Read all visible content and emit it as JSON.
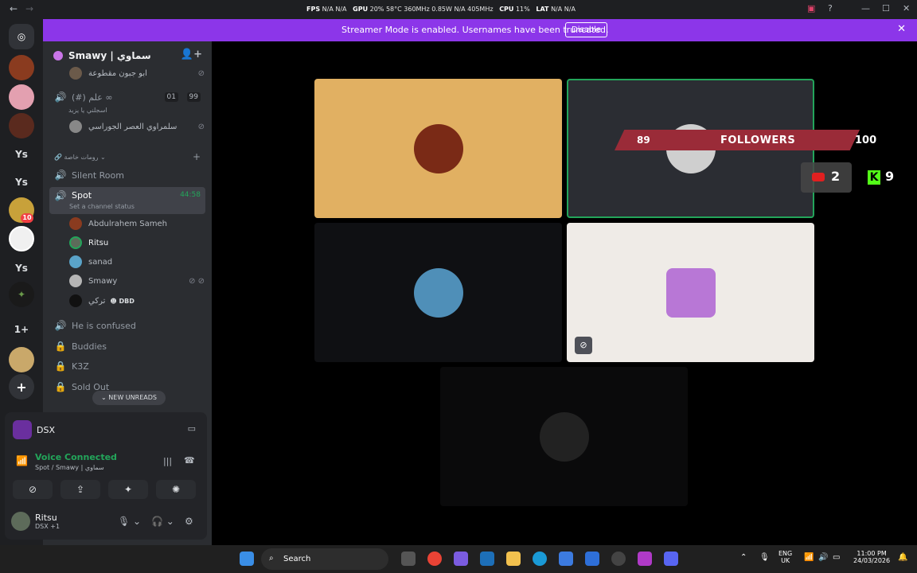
{
  "titlebar": {
    "stats": {
      "fps_label": "FPS",
      "fps_value": "N/A",
      "fps_value2": "N/A",
      "gpu_label": "GPU",
      "gpu_value": "20%  58°C  360MHz  0.85W  N/A  405MHz",
      "cpu_label": "CPU",
      "cpu_value": "11%",
      "lat_label": "LAT",
      "lat_value": "N/A",
      "lat_value2": "N/A"
    },
    "window_title": "Smawy | سماوي"
  },
  "banner": {
    "message": "Streamer Mode is enabled. Usernames have been truncated.",
    "disable_label": "Disable"
  },
  "rail": {
    "servers": [
      "Ys",
      "Ys",
      "Ys",
      "1+"
    ],
    "badge": "10"
  },
  "guild": {
    "name": "Smawy | سماوي"
  },
  "channels": {
    "top_user": "ابو جبون مقطوعة",
    "room1": {
      "name": "(#) علم ∞",
      "sub": "اسجلني يا يزيد",
      "count1": "01",
      "count2": "99"
    },
    "room1_user": "سلمراوي العصر الجوراسي",
    "category": "رومات خاصة",
    "silent_room": "Silent Room",
    "spot": {
      "name": "Spot",
      "status": "Set a channel status",
      "timer": "44:58"
    },
    "spot_users": [
      {
        "name": "Abdulrahem Sameh"
      },
      {
        "name": "Ritsu"
      },
      {
        "name": "sanad"
      },
      {
        "name": "Smawy"
      },
      {
        "name": "تركي",
        "extra": "DBD"
      }
    ],
    "he_is_confused": "He is confused",
    "buddies": "Buddies",
    "k3z": "K3Z",
    "sold_out": "Sold Out",
    "new_unreads": "NEW UNREADS"
  },
  "panel": {
    "activity": "DSX",
    "voice_connected": "Voice Connected",
    "voice_sub": "Spot / Smawy | سماوي",
    "user_name": "Ritsu",
    "user_status": "DSX +1"
  },
  "overlay": {
    "followers_count": "89",
    "followers_label": "FOLLOWERS",
    "followers_goal": "100",
    "youtube_count": "2",
    "kick_count": "9"
  },
  "taskbar": {
    "search": "Search",
    "lang1": "ENG",
    "lang2": "UK",
    "time": "11:00 PM",
    "date": "24/03/2026"
  }
}
